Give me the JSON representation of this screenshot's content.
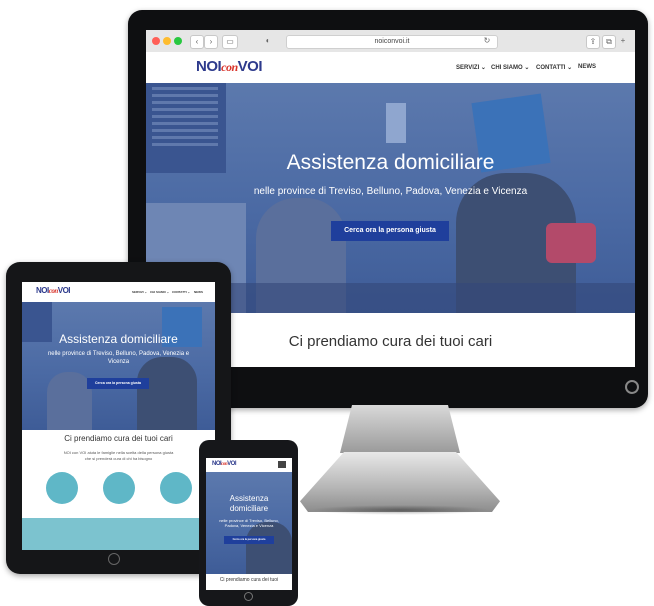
{
  "browser": {
    "url": "noiconvoi.it"
  },
  "site": {
    "logo_left": "NOI",
    "logo_mid": "con",
    "logo_right": "VOI",
    "nav": [
      "SERVIZI ⌄",
      "CHI SIAMO ⌄",
      "CONTATTI ⌄",
      "NEWS"
    ],
    "hero_title": "Assistenza domiciliare",
    "hero_subtitle": "nelle province di Treviso, Belluno, Padova, Venezia e Vicenza",
    "cta_label": "Cerca ora la persona giusta",
    "section_title": "Ci prendiamo cura dei tuoi cari"
  },
  "tablet": {
    "intro_line1": "NOI con VOI aiuta le famiglie nella scelta della persona giusta",
    "intro_line2": "che si prenderà cura di chi ha bisogno"
  },
  "phone": {
    "hero_title_line1": "Assistenza",
    "hero_title_line2": "domiciliare",
    "hero_subtitle": "nelle province di Treviso, Belluno, Padova, Venezia e Vicenza",
    "section_title": "Ci prendiamo cura dei tuoi"
  },
  "colors": {
    "brand": "#2d3a8c",
    "accent": "#d9342b",
    "hero_overlay": "#4b6aa4",
    "cta": "#1f3f9c",
    "teal": "#5fb7c7"
  }
}
